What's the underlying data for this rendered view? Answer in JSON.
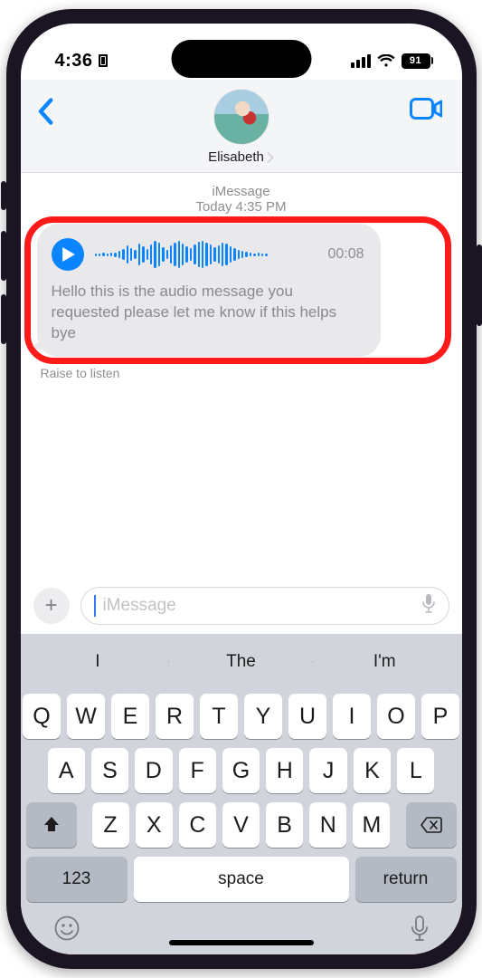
{
  "status": {
    "time": "4:36",
    "battery": "91"
  },
  "header": {
    "contact_name": "Elisabeth"
  },
  "conversation": {
    "service_label": "iMessage",
    "timestamp": "Today 4:35 PM",
    "audio_msg": {
      "duration": "00:08",
      "transcript": "Hello this is the audio message you requested please let me know if this helps bye"
    },
    "hint": "Raise to listen"
  },
  "composer": {
    "placeholder": "iMessage"
  },
  "keyboard": {
    "suggest": [
      "I",
      "The",
      "I'm"
    ],
    "row1": [
      "Q",
      "W",
      "E",
      "R",
      "T",
      "Y",
      "U",
      "I",
      "O",
      "P"
    ],
    "row2": [
      "A",
      "S",
      "D",
      "F",
      "G",
      "H",
      "J",
      "K",
      "L"
    ],
    "row3": [
      "Z",
      "X",
      "C",
      "V",
      "B",
      "N",
      "M"
    ],
    "numbers_label": "123",
    "space_label": "space",
    "return_label": "return"
  },
  "wave_heights": [
    3,
    3,
    4,
    3,
    4,
    5,
    8,
    12,
    20,
    14,
    10,
    24,
    18,
    12,
    22,
    30,
    26,
    16,
    10,
    20,
    26,
    30,
    24,
    18,
    14,
    22,
    28,
    30,
    26,
    22,
    16,
    20,
    26,
    24,
    18,
    14,
    10,
    8,
    6,
    4,
    3,
    4,
    3,
    3
  ]
}
